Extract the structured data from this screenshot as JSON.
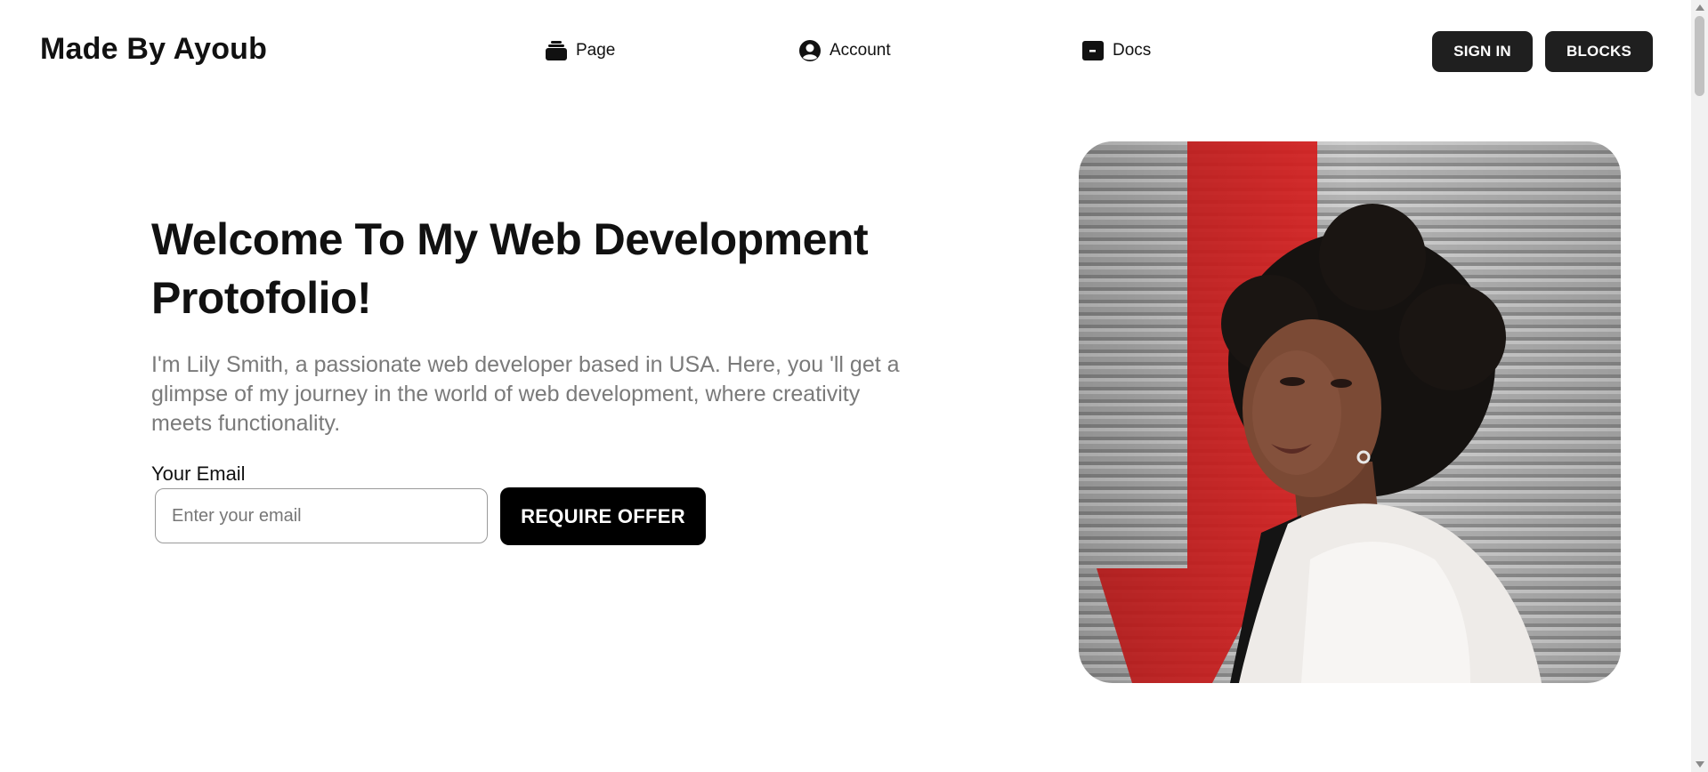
{
  "header": {
    "brand": "Made By Ayoub",
    "nav": [
      {
        "label": "Page",
        "icon": "stack-icon"
      },
      {
        "label": "Account",
        "icon": "user-circle-icon"
      },
      {
        "label": "Docs",
        "icon": "terminal-icon"
      }
    ],
    "signin_label": "SIGN IN",
    "blocks_label": "BLOCKS"
  },
  "hero": {
    "title": "Welcome To My Web Development Protofolio!",
    "subtitle": "I'm Lily Smith, a passionate web developer based in USA. Here, you 'll get a glimpse of my journey in the world of web development, where creativity meets functionality.",
    "email_label": "Your Email",
    "email_placeholder": "Enter your email",
    "email_value": "",
    "cta_label": "REQUIRE OFFER"
  },
  "colors": {
    "button_dark": "#1f1f1f",
    "cta": "#000000",
    "subtitle": "#7a7a7a",
    "photo_background": "#a9a9a9",
    "photo_stripe": "#d9201f"
  }
}
